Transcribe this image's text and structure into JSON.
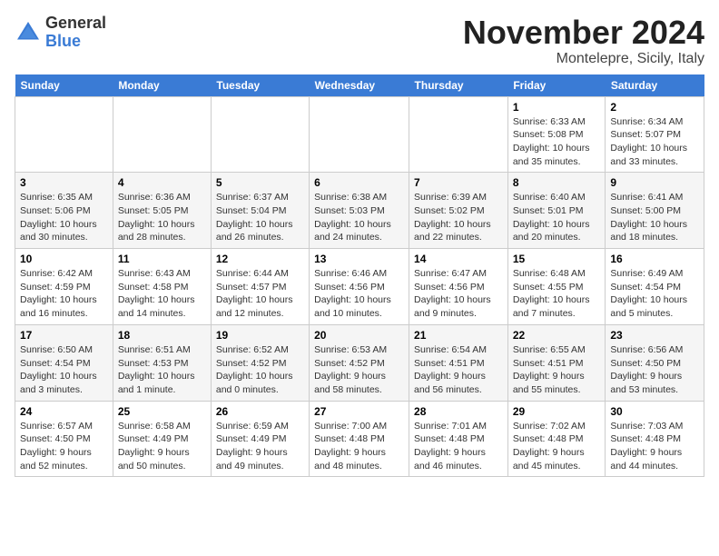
{
  "header": {
    "logo_general": "General",
    "logo_blue": "Blue",
    "title": "November 2024",
    "location": "Montelepre, Sicily, Italy"
  },
  "weekdays": [
    "Sunday",
    "Monday",
    "Tuesday",
    "Wednesday",
    "Thursday",
    "Friday",
    "Saturday"
  ],
  "weeks": [
    [
      {
        "day": "",
        "info": ""
      },
      {
        "day": "",
        "info": ""
      },
      {
        "day": "",
        "info": ""
      },
      {
        "day": "",
        "info": ""
      },
      {
        "day": "",
        "info": ""
      },
      {
        "day": "1",
        "info": "Sunrise: 6:33 AM\nSunset: 5:08 PM\nDaylight: 10 hours and 35 minutes."
      },
      {
        "day": "2",
        "info": "Sunrise: 6:34 AM\nSunset: 5:07 PM\nDaylight: 10 hours and 33 minutes."
      }
    ],
    [
      {
        "day": "3",
        "info": "Sunrise: 6:35 AM\nSunset: 5:06 PM\nDaylight: 10 hours and 30 minutes."
      },
      {
        "day": "4",
        "info": "Sunrise: 6:36 AM\nSunset: 5:05 PM\nDaylight: 10 hours and 28 minutes."
      },
      {
        "day": "5",
        "info": "Sunrise: 6:37 AM\nSunset: 5:04 PM\nDaylight: 10 hours and 26 minutes."
      },
      {
        "day": "6",
        "info": "Sunrise: 6:38 AM\nSunset: 5:03 PM\nDaylight: 10 hours and 24 minutes."
      },
      {
        "day": "7",
        "info": "Sunrise: 6:39 AM\nSunset: 5:02 PM\nDaylight: 10 hours and 22 minutes."
      },
      {
        "day": "8",
        "info": "Sunrise: 6:40 AM\nSunset: 5:01 PM\nDaylight: 10 hours and 20 minutes."
      },
      {
        "day": "9",
        "info": "Sunrise: 6:41 AM\nSunset: 5:00 PM\nDaylight: 10 hours and 18 minutes."
      }
    ],
    [
      {
        "day": "10",
        "info": "Sunrise: 6:42 AM\nSunset: 4:59 PM\nDaylight: 10 hours and 16 minutes."
      },
      {
        "day": "11",
        "info": "Sunrise: 6:43 AM\nSunset: 4:58 PM\nDaylight: 10 hours and 14 minutes."
      },
      {
        "day": "12",
        "info": "Sunrise: 6:44 AM\nSunset: 4:57 PM\nDaylight: 10 hours and 12 minutes."
      },
      {
        "day": "13",
        "info": "Sunrise: 6:46 AM\nSunset: 4:56 PM\nDaylight: 10 hours and 10 minutes."
      },
      {
        "day": "14",
        "info": "Sunrise: 6:47 AM\nSunset: 4:56 PM\nDaylight: 10 hours and 9 minutes."
      },
      {
        "day": "15",
        "info": "Sunrise: 6:48 AM\nSunset: 4:55 PM\nDaylight: 10 hours and 7 minutes."
      },
      {
        "day": "16",
        "info": "Sunrise: 6:49 AM\nSunset: 4:54 PM\nDaylight: 10 hours and 5 minutes."
      }
    ],
    [
      {
        "day": "17",
        "info": "Sunrise: 6:50 AM\nSunset: 4:54 PM\nDaylight: 10 hours and 3 minutes."
      },
      {
        "day": "18",
        "info": "Sunrise: 6:51 AM\nSunset: 4:53 PM\nDaylight: 10 hours and 1 minute."
      },
      {
        "day": "19",
        "info": "Sunrise: 6:52 AM\nSunset: 4:52 PM\nDaylight: 10 hours and 0 minutes."
      },
      {
        "day": "20",
        "info": "Sunrise: 6:53 AM\nSunset: 4:52 PM\nDaylight: 9 hours and 58 minutes."
      },
      {
        "day": "21",
        "info": "Sunrise: 6:54 AM\nSunset: 4:51 PM\nDaylight: 9 hours and 56 minutes."
      },
      {
        "day": "22",
        "info": "Sunrise: 6:55 AM\nSunset: 4:51 PM\nDaylight: 9 hours and 55 minutes."
      },
      {
        "day": "23",
        "info": "Sunrise: 6:56 AM\nSunset: 4:50 PM\nDaylight: 9 hours and 53 minutes."
      }
    ],
    [
      {
        "day": "24",
        "info": "Sunrise: 6:57 AM\nSunset: 4:50 PM\nDaylight: 9 hours and 52 minutes."
      },
      {
        "day": "25",
        "info": "Sunrise: 6:58 AM\nSunset: 4:49 PM\nDaylight: 9 hours and 50 minutes."
      },
      {
        "day": "26",
        "info": "Sunrise: 6:59 AM\nSunset: 4:49 PM\nDaylight: 9 hours and 49 minutes."
      },
      {
        "day": "27",
        "info": "Sunrise: 7:00 AM\nSunset: 4:48 PM\nDaylight: 9 hours and 48 minutes."
      },
      {
        "day": "28",
        "info": "Sunrise: 7:01 AM\nSunset: 4:48 PM\nDaylight: 9 hours and 46 minutes."
      },
      {
        "day": "29",
        "info": "Sunrise: 7:02 AM\nSunset: 4:48 PM\nDaylight: 9 hours and 45 minutes."
      },
      {
        "day": "30",
        "info": "Sunrise: 7:03 AM\nSunset: 4:48 PM\nDaylight: 9 hours and 44 minutes."
      }
    ]
  ]
}
